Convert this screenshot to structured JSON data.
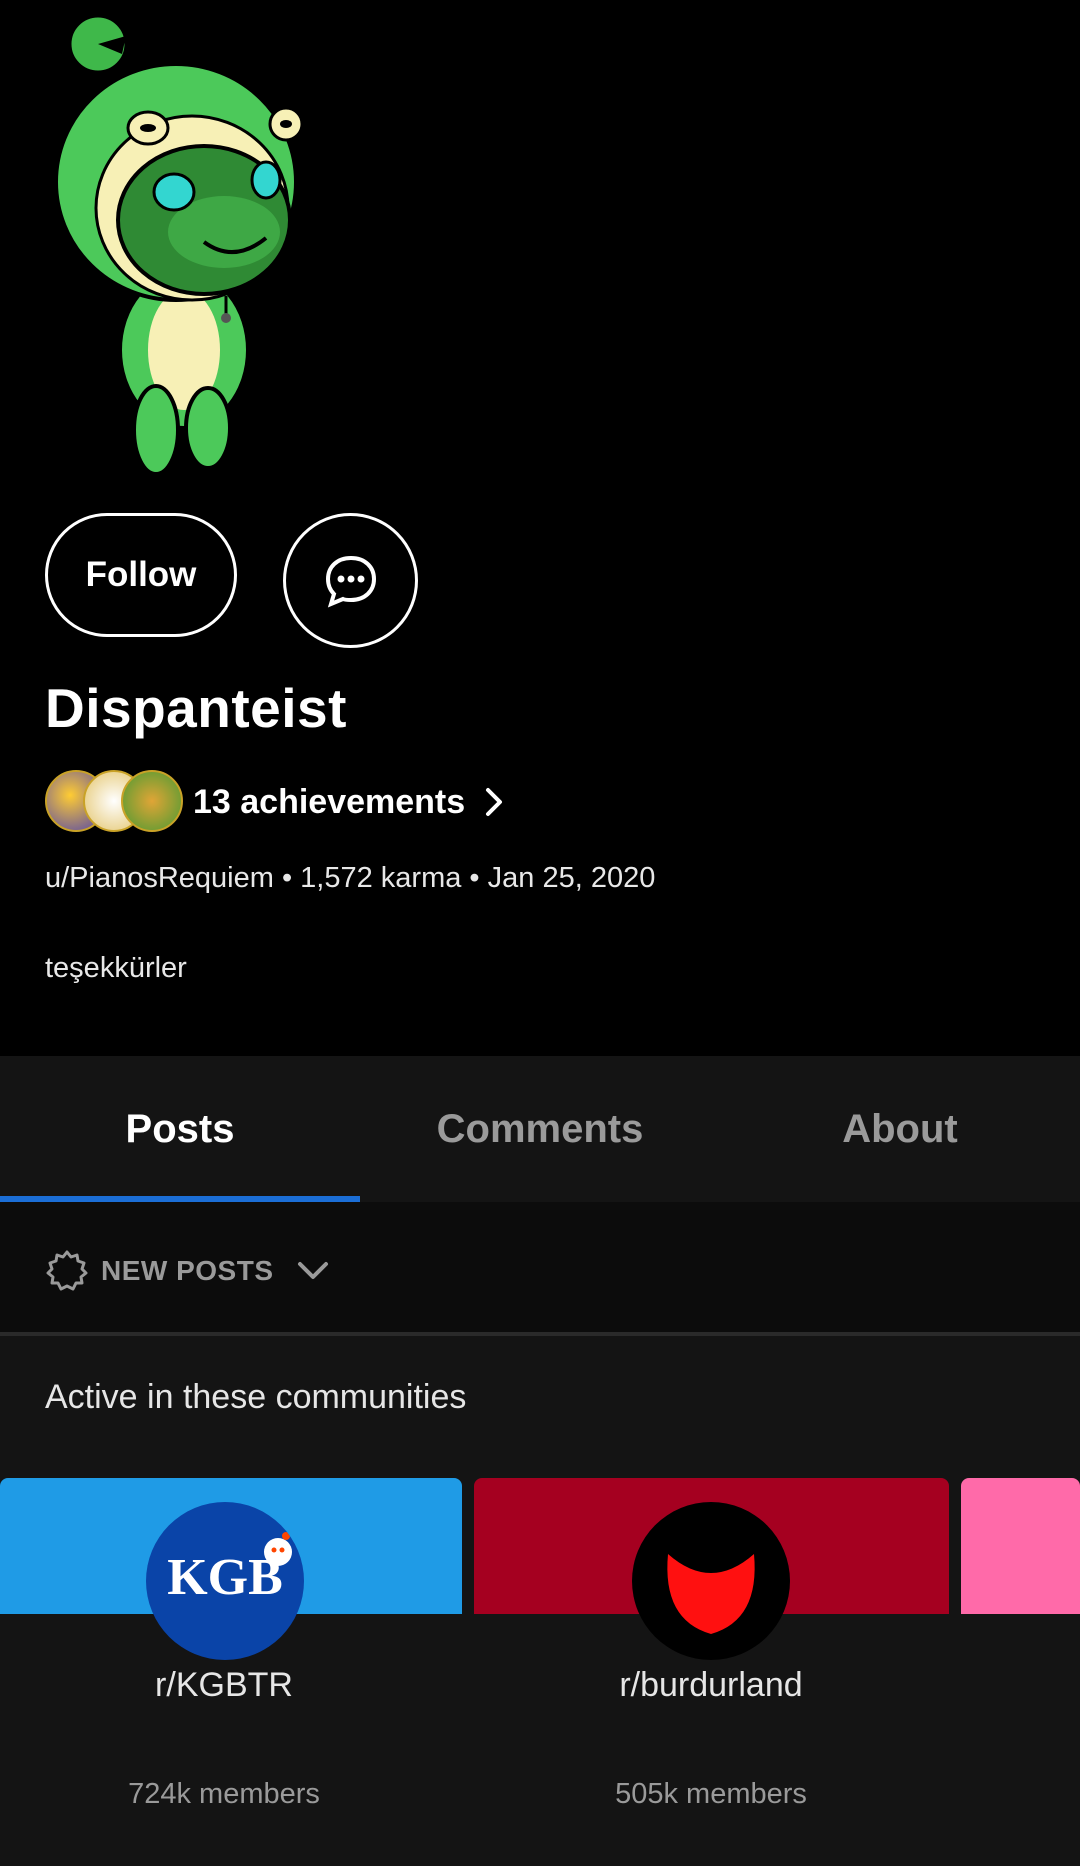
{
  "profile": {
    "display_name": "Dispanteist",
    "follow_label": "Follow",
    "achievements_label": "13 achievements",
    "meta_line": "u/PianosRequiem • 1,572 karma • Jan 25, 2020",
    "bio": "teşekkürler"
  },
  "tabs": [
    {
      "label": "Posts",
      "active": true
    },
    {
      "label": "Comments",
      "active": false
    },
    {
      "label": "About",
      "active": false
    }
  ],
  "sort": {
    "label": "NEW POSTS"
  },
  "communities": {
    "title": "Active in these communities",
    "items": [
      {
        "name": "r/KGBTR",
        "members": "724k members",
        "banner_color": "#1f9be6",
        "icon_text": "KGB"
      },
      {
        "name": "r/burdurland",
        "members": "505k members",
        "banner_color": "#a50020"
      },
      {
        "banner_color": "#ff6aa9"
      }
    ]
  },
  "colors": {
    "accent": "#1b6ed6",
    "background": "#000000",
    "surface": "#141414"
  },
  "icons": [
    "snoo-avatar",
    "chat-icon",
    "chevron-right-icon",
    "sort-new-icon",
    "chevron-down-icon"
  ]
}
